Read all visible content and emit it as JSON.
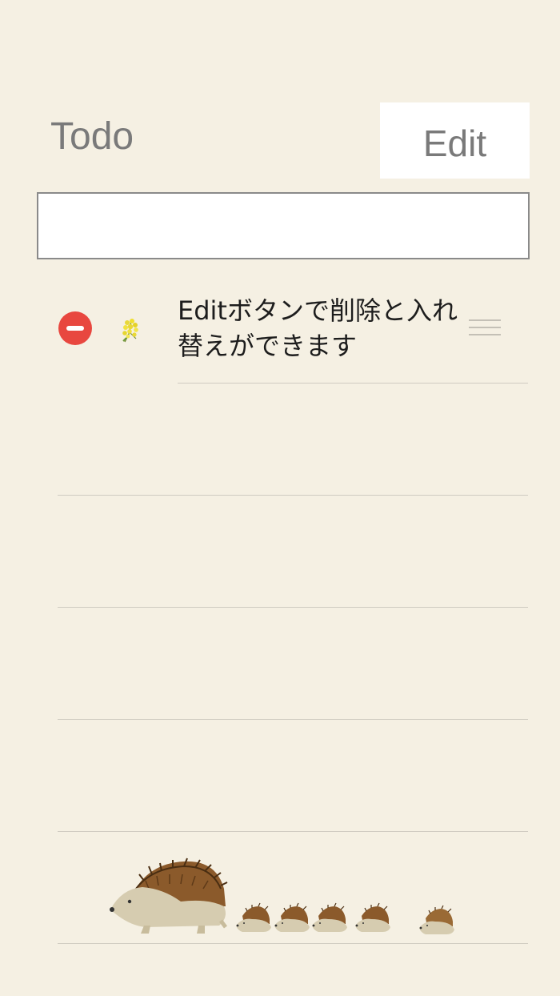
{
  "header": {
    "title": "Todo",
    "edit_label": "Edit"
  },
  "new_item": {
    "value": "",
    "placeholder": ""
  },
  "list": {
    "items": [
      {
        "text": "Editボタンで削除と入れ替えができます",
        "icon": "mimosa-flower-icon"
      }
    ]
  },
  "decoration": {
    "illustration": "hedgehog-family-icon"
  },
  "colors": {
    "background": "#f5f0e3",
    "delete": "#e8473f",
    "title_text": "#7a7a7a"
  }
}
